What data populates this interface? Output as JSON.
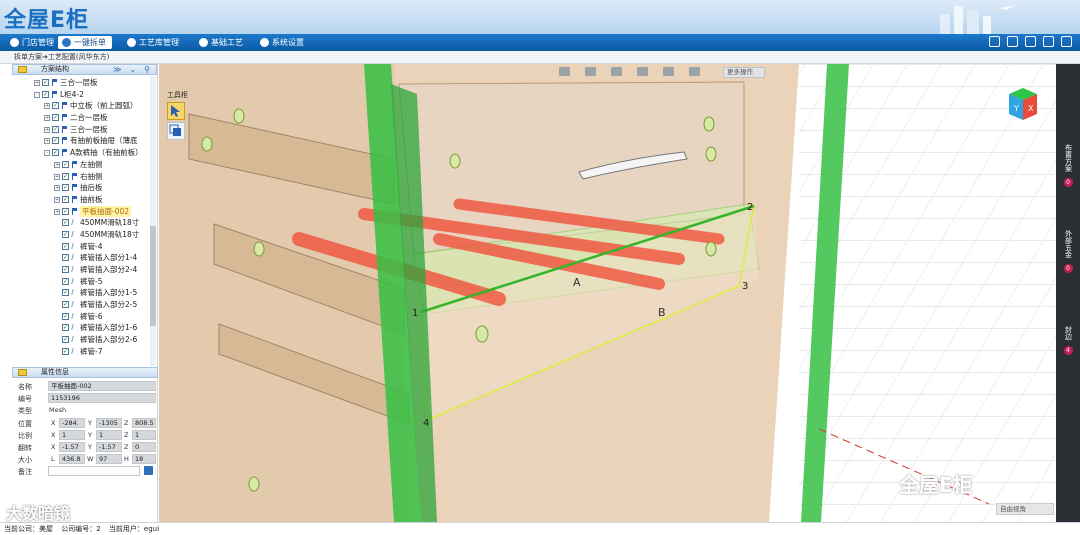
{
  "header": {
    "logo": "全屋E柜"
  },
  "nav": {
    "items": [
      {
        "label": "门店管理",
        "active": false
      },
      {
        "label": "一键拆单",
        "active": true
      },
      {
        "label": "工艺库管理",
        "active": false
      },
      {
        "label": "基础工艺",
        "active": false
      },
      {
        "label": "系统设置",
        "active": false
      }
    ]
  },
  "breadcrumb": "拆单方案➔工艺配置(风华东方)",
  "left_panel": {
    "title": "方案结构",
    "tree": [
      {
        "label": "三合一层板",
        "level": 1,
        "expander": "+"
      },
      {
        "label": "L柜4-2",
        "level": 1,
        "expander": "-"
      },
      {
        "label": "中立板（前上圆弧）",
        "level": 2,
        "expander": "+"
      },
      {
        "label": "二合一层板",
        "level": 2,
        "expander": "+"
      },
      {
        "label": "三合一层板",
        "level": 2,
        "expander": "+"
      },
      {
        "label": "有抽前板抽屉（薄底",
        "level": 2,
        "expander": "+"
      },
      {
        "label": "A款裤抽（有抽前板）",
        "level": 2,
        "expander": "-"
      },
      {
        "label": "左抽侧",
        "level": 3,
        "expander": "+"
      },
      {
        "label": "右抽侧",
        "level": 3,
        "expander": "+"
      },
      {
        "label": "抽后板",
        "level": 3,
        "expander": "+"
      },
      {
        "label": "抽前板",
        "level": 3,
        "expander": "+"
      },
      {
        "label": "平板抽面-002",
        "level": 3,
        "expander": "+",
        "selected": true
      },
      {
        "label": "450MM滑轨18寸",
        "level": 3,
        "leaf": true
      },
      {
        "label": "450MM滑轨18寸",
        "level": 3,
        "leaf": true
      },
      {
        "label": "裤管-4",
        "level": 3,
        "leaf": true
      },
      {
        "label": "裤管插入部分1-4",
        "level": 3,
        "leaf": true
      },
      {
        "label": "裤管插入部分2-4",
        "level": 3,
        "leaf": true
      },
      {
        "label": "裤管-5",
        "level": 3,
        "leaf": true
      },
      {
        "label": "裤管插入部分1-5",
        "level": 3,
        "leaf": true
      },
      {
        "label": "裤管插入部分2-5",
        "level": 3,
        "leaf": true
      },
      {
        "label": "裤管-6",
        "level": 3,
        "leaf": true
      },
      {
        "label": "裤管插入部分1-6",
        "level": 3,
        "leaf": true
      },
      {
        "label": "裤管插入部分2-6",
        "level": 3,
        "leaf": true
      },
      {
        "label": "裤管-7",
        "level": 3,
        "leaf": true
      }
    ]
  },
  "properties": {
    "title": "属性信息",
    "name_label": "名称",
    "name_value": "平板抽面-002",
    "id_label": "编号",
    "id_value": "1153196",
    "type_label": "类型",
    "type_value": "Mesh",
    "pos_label": "位置",
    "pos": {
      "x": "-284.",
      "y": "-1305",
      "z": "808.5"
    },
    "scale_label": "比例",
    "scale": {
      "x": "1",
      "y": "1",
      "z": "1"
    },
    "rot_label": "翻转",
    "rot": {
      "x": "-1.57",
      "y": "-1.57",
      "z": "0"
    },
    "size_label": "大小",
    "size": {
      "l": "436.8",
      "w": "97",
      "h": "18"
    },
    "note_label": "备注",
    "note_value": ""
  },
  "viewport": {
    "toolbox_label": "工具柜",
    "more_ops": "更多操作",
    "view_select": "自由视角",
    "labels": {
      "a": "A",
      "b": "B",
      "p1": "1",
      "p2": "2",
      "p3": "3",
      "p4": "4"
    },
    "cube_faces": {
      "front": "Y",
      "side": "X"
    },
    "watermark": "全屋E柜"
  },
  "right_rail": [
    {
      "label": "布置方案",
      "badge": "0"
    },
    {
      "label": "外部五金",
      "badge": "0"
    },
    {
      "label": "封边",
      "badge": "4"
    }
  ],
  "status": {
    "company": "当前公司：美屋",
    "company_no": "公司编号：2",
    "user": "当前用户：egui"
  },
  "overlay": "大数暗镜",
  "colors": {
    "nav": "#0d5aa4",
    "frame_green": "#35c043",
    "highlight": "#d9ef3c",
    "tube_red": "#f0523c",
    "wood": "#ead3b8"
  }
}
